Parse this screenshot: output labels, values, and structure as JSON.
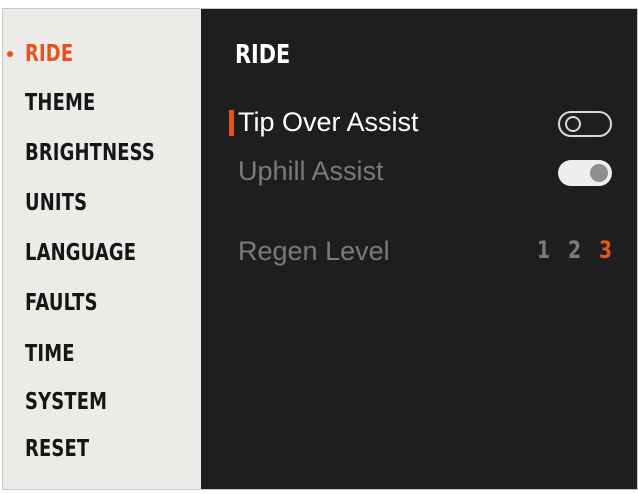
{
  "sidebar": {
    "items": [
      {
        "label": "RIDE",
        "active": true
      },
      {
        "label": "THEME"
      },
      {
        "label": "BRIGHTNESS"
      },
      {
        "label": "UNITS"
      },
      {
        "label": "LANGUAGE"
      },
      {
        "label": "FAULTS"
      },
      {
        "label": "TIME"
      },
      {
        "label": "SYSTEM"
      },
      {
        "label": "RESET"
      }
    ]
  },
  "main": {
    "title": "RIDE",
    "settings": {
      "tip_over_assist": {
        "label": "Tip Over Assist",
        "enabled": false,
        "focused": true
      },
      "uphill_assist": {
        "label": "Uphill Assist",
        "enabled": true
      },
      "regen_level": {
        "label": "Regen Level",
        "options": [
          "1",
          "2",
          "3"
        ],
        "selected": "3"
      }
    }
  },
  "colors": {
    "accent": "#e8521e",
    "sidebar_bg": "#ecebe8",
    "main_bg": "#1e1e1e",
    "muted_text": "#7a7a7a"
  }
}
